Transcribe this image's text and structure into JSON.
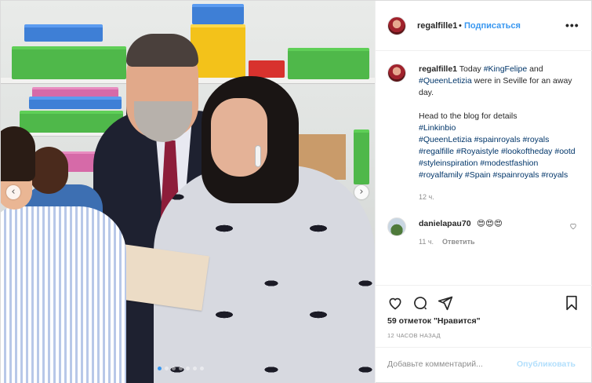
{
  "header": {
    "username": "regalfille1",
    "separator": "•",
    "follow_label": "Подписаться",
    "more_icon": "more-horizontal-icon",
    "more_label": "•••"
  },
  "caption": {
    "username": "regalfille1",
    "text_before": " Today ",
    "tag1": "#KingFelipe",
    "text_and": " and ",
    "tag2": "#QueenLetizia",
    "text_after": " were in Seville for an away day.",
    "line2": "Head to the blog for details",
    "hashtags_line1": "#Linkinbio",
    "hashtags_line2": "#QueenLetizia #spainroyals #royals #regalfille #Royaistyle #lookoftheday #ootd #styleinspiration #modestfashion #royalfamily #Spain #spainroyals #royals",
    "time": "12 ч."
  },
  "comment": {
    "username": "danielapau70",
    "text": "😍😍😍",
    "time": "11 ч.",
    "reply_label": "Ответить"
  },
  "actions": {
    "icons": [
      "heart-icon",
      "comment-icon",
      "share-icon",
      "bookmark-icon"
    ]
  },
  "likes_text": "59 отметок \"Нравится\"",
  "time_ago": "12 ЧАСОВ НАЗАД",
  "add_comment": {
    "placeholder": "Добавьте комментарий...",
    "publish_label": "Опубликовать"
  },
  "carousel": {
    "prev_label": "‹",
    "next_label": "›",
    "slides_total": 7,
    "active_slide": 1
  },
  "colors": {
    "accent": "#3897f0",
    "publish_disabled": "#b2dffc",
    "hashtag": "#003569",
    "muted": "#8e8e8e"
  }
}
